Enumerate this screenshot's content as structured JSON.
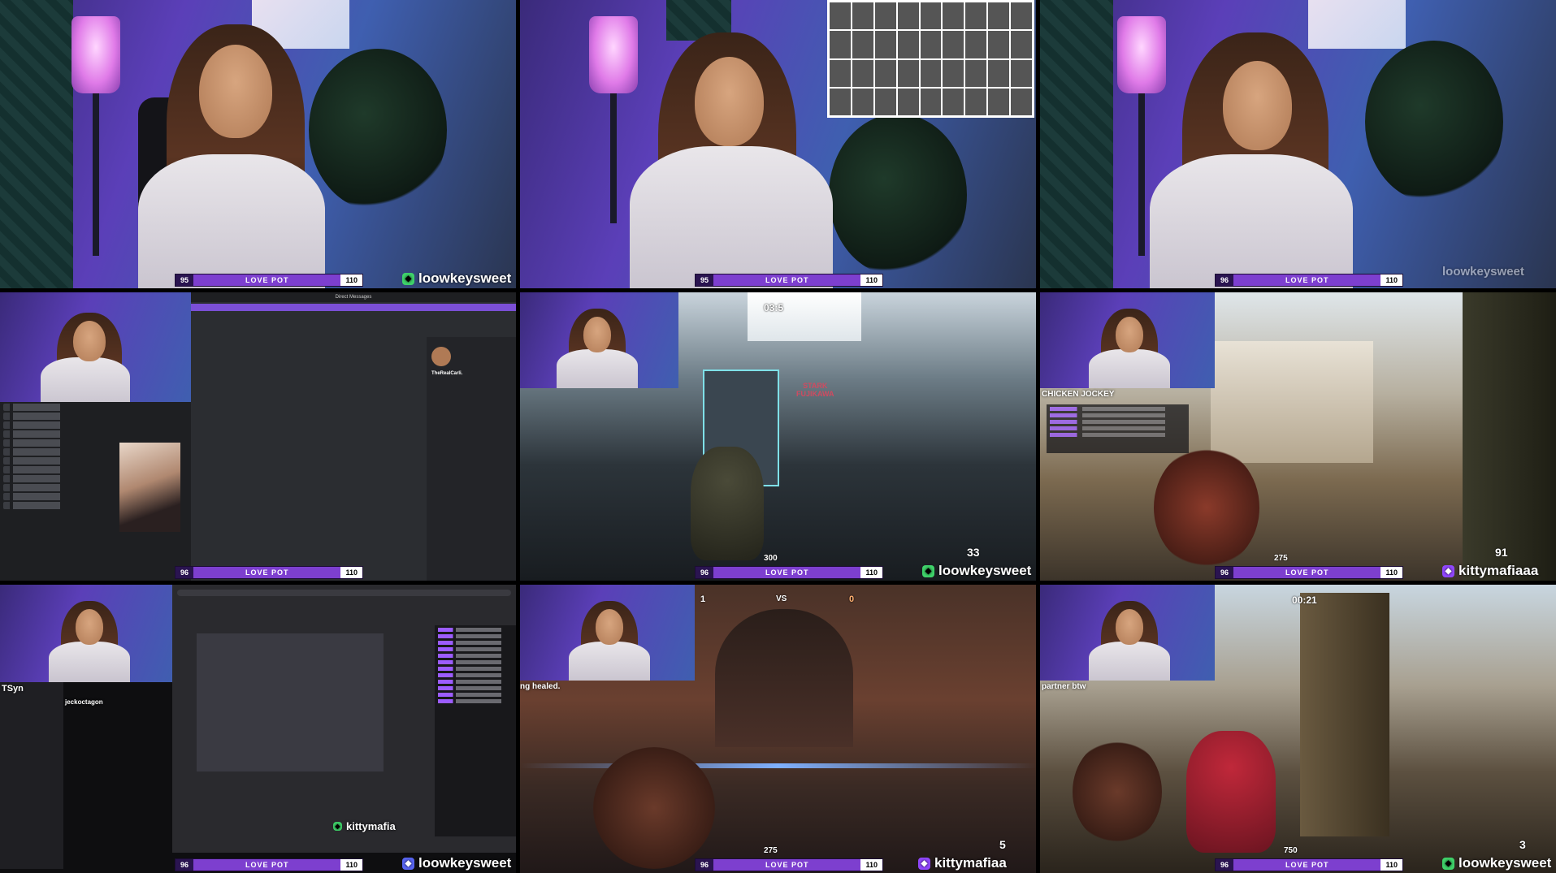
{
  "overlay": {
    "bar_left": "95",
    "bar_left_alt": "96",
    "bar_label": "LOVE POT",
    "bar_right": "110"
  },
  "handles": {
    "loowkeysweet": "loowkeysweet",
    "kittymafiaaa": "kittymafiaaa",
    "kittymafiaa": "kittymafiaa",
    "kittymafia": "kittymafia"
  },
  "captions": {
    "chicken_jockey": "CHICKEN JOCKEY",
    "ng_healed": "ng healed.",
    "partner_btw": "partner btw",
    "tsyn": "TSyn",
    "jeckoctagon": "jeckoctagon",
    "stark": "STARK\nFUJIKAWA",
    "direct_messages": "Direct Messages",
    "profile_name": "TheRealCarli.",
    "match_timer": "03:5",
    "ammo_300": "300",
    "hp_275": "275",
    "hp_750": "750",
    "ult_33": "33",
    "ult_91": "91",
    "ult_5": "5",
    "ult_3": "3",
    "timer_0021": "00:21",
    "score_0": "0",
    "score_1": "1",
    "vs": "VS"
  },
  "colors": {
    "bar_purple": "#7d3fcf",
    "handle_green": "#3fd36a",
    "twitch_purple": "#9147ff",
    "discord_blurple": "#5865f2"
  }
}
